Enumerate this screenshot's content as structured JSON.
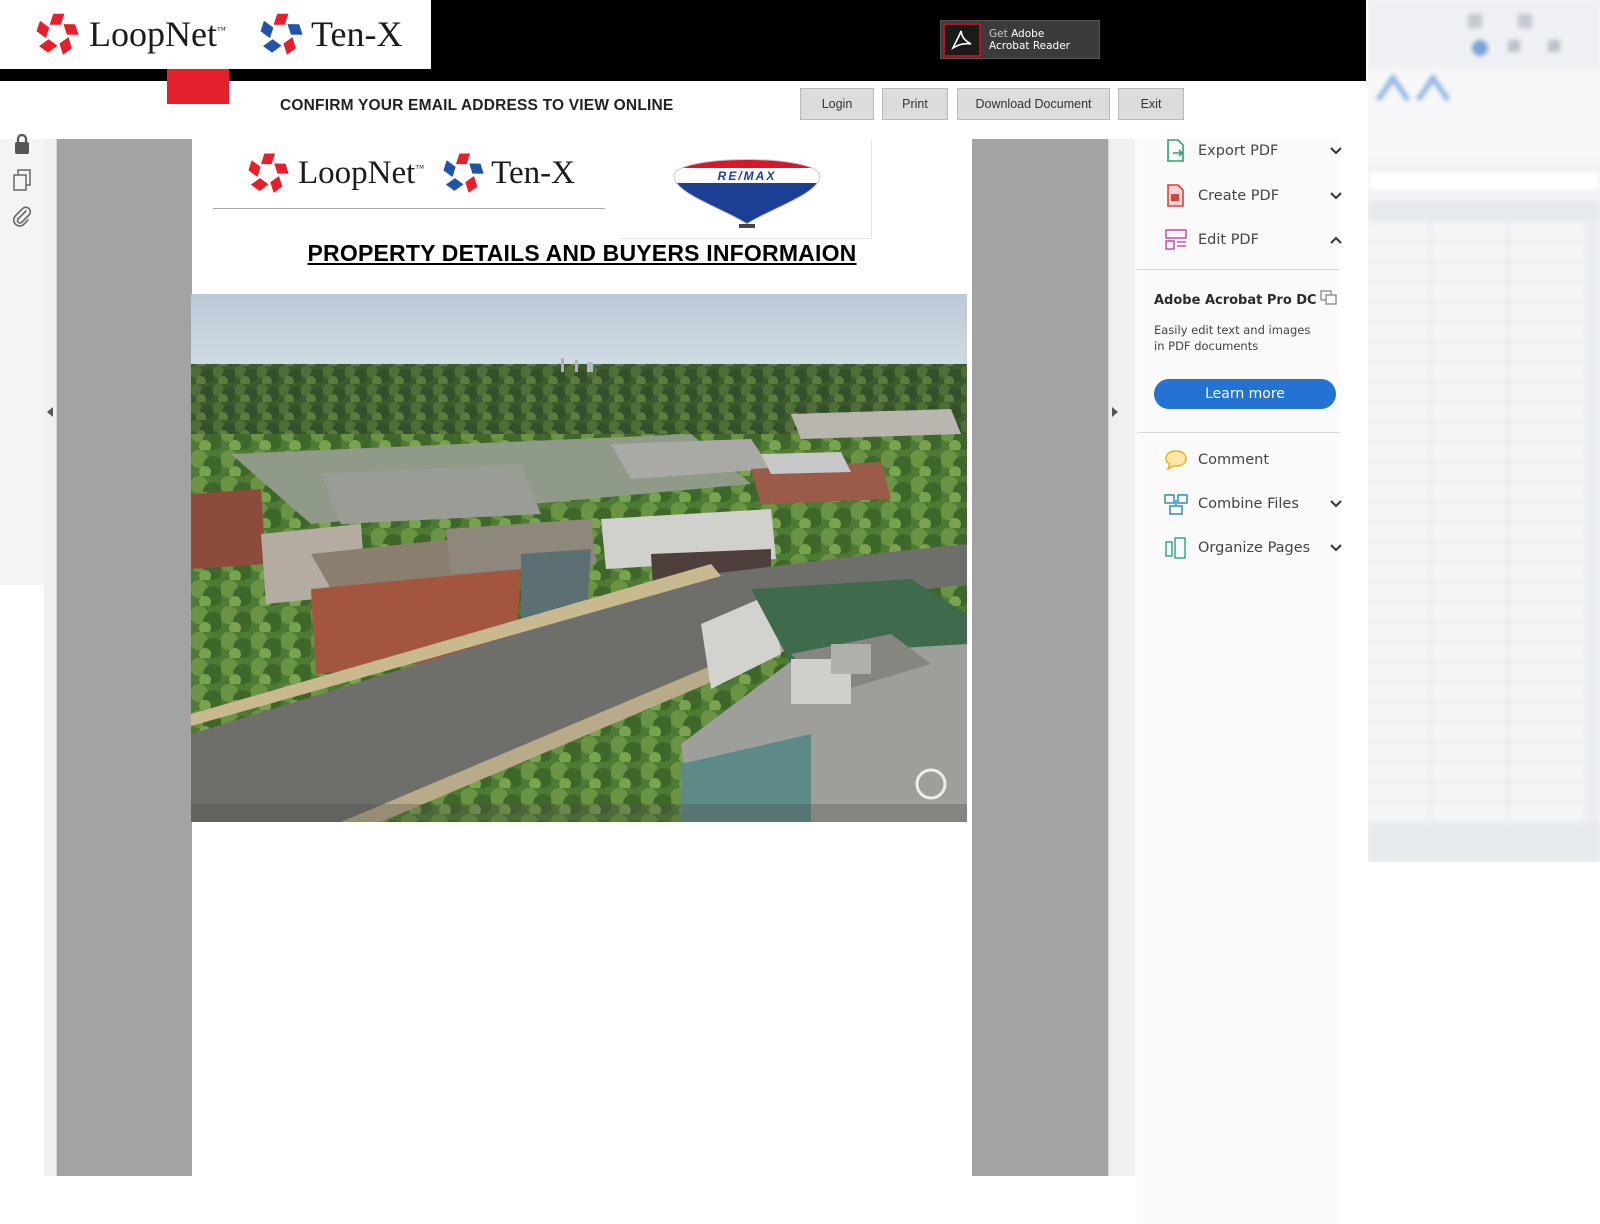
{
  "brand": {
    "loopnet": "LoopNet",
    "tenx": "Ten-X",
    "tm": "™"
  },
  "adobe_badge": {
    "line1_prefix": "Get ",
    "line1_strong": "Adobe",
    "line2": "Acrobat Reader"
  },
  "header": {
    "confirm_text": "CONFIRM YOUR EMAIL ADDRESS TO VIEW ONLINE",
    "buttons": {
      "login": "Login",
      "print": "Print",
      "download": "Download Document",
      "exit": "Exit"
    }
  },
  "document": {
    "logo_loopnet": "LoopNet",
    "logo_tenx": "Ten-X",
    "remax_text": "RE/MAX",
    "title": "PROPERTY DETAILS AND BUYERS INFORMAION"
  },
  "tools_panel": {
    "items_top": [
      {
        "label": "Export PDF",
        "icon": "export-pdf-icon",
        "chevron": "down"
      },
      {
        "label": "Create PDF",
        "icon": "create-pdf-icon",
        "chevron": "down"
      },
      {
        "label": "Edit PDF",
        "icon": "edit-pdf-icon",
        "chevron": "up"
      }
    ],
    "promo": {
      "title": "Adobe Acrobat Pro DC",
      "desc": "Easily edit text and images in PDF documents",
      "button": "Learn more"
    },
    "items_bottom": [
      {
        "label": "Comment",
        "icon": "comment-icon"
      },
      {
        "label": "Combine Files",
        "icon": "combine-files-icon",
        "chevron": "down"
      },
      {
        "label": "Organize Pages",
        "icon": "organize-pages-icon",
        "chevron": "down"
      }
    ]
  },
  "colors": {
    "loopnet_red": "#e3202b",
    "tenx_blue": "#1f54a8",
    "acrobat_blue": "#2473d2",
    "viewer_gray": "#a3a3a3"
  }
}
